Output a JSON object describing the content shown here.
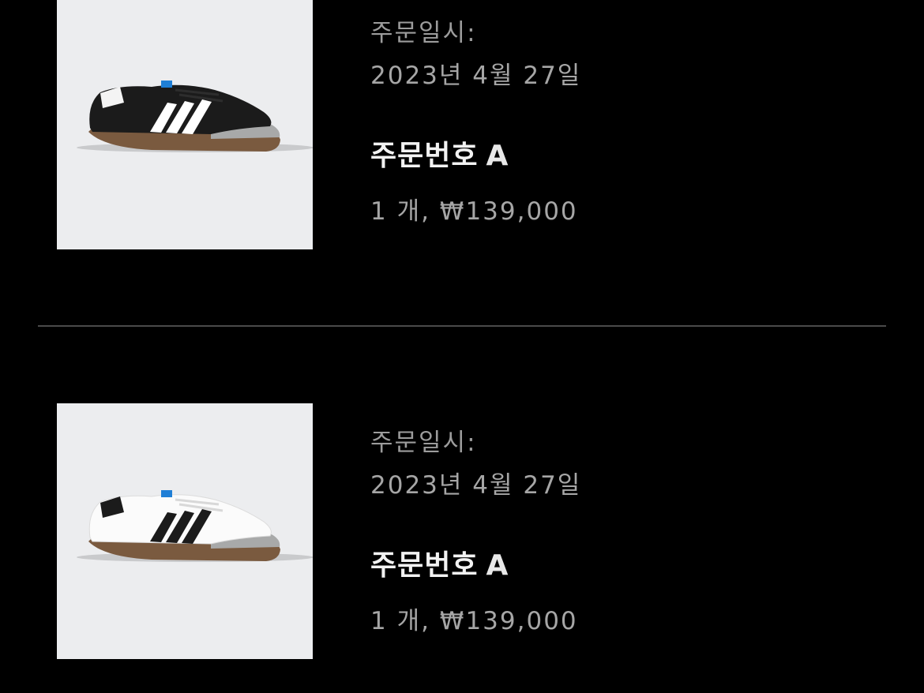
{
  "orders": [
    {
      "date_label": "주문일시:",
      "date_value": "2023년 4월 27일",
      "order_no_label": "주문번호",
      "order_no_value": "A",
      "summary": "1 개, ₩139,000",
      "product_color": "black"
    },
    {
      "date_label": "주문일시:",
      "date_value": "2023년 4월 27일",
      "order_no_label": "주문번호",
      "order_no_value": "A",
      "summary": "1 개, ₩139,000",
      "product_color": "white"
    }
  ],
  "colors": {
    "background": "#000000",
    "thumbnail_bg": "#ecedef",
    "divider": "#4a4a4a"
  }
}
